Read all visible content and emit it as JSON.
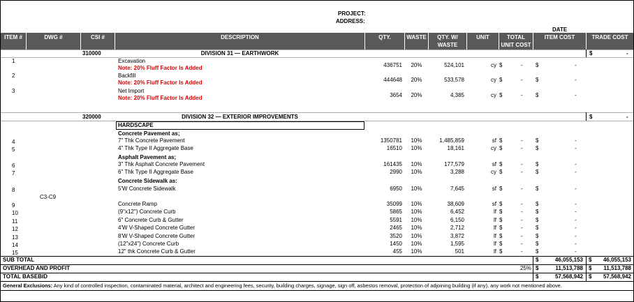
{
  "header": {
    "project_label": "PROJECT:",
    "address_label": "ADDRESS:",
    "date_label": "DATE"
  },
  "columns": {
    "item": "ITEM #",
    "dwg": "DWG #",
    "csi": "CSI #",
    "description": "DESCRIPTION",
    "qty": "QTY.",
    "waste": "WASTE",
    "qty_w_1": "QTY. W/",
    "qty_w_2": "WASTE",
    "unit": "UNIT",
    "total_1": "TOTAL",
    "total_2": "UNIT COST",
    "item_cost": "ITEM COST",
    "trade_cost": "TRADE COST"
  },
  "divisions": [
    {
      "csi": "310000",
      "title": "DIVISION 31 — EARTHWORK",
      "currency": "$",
      "trade": "-"
    },
    {
      "csi": "320000",
      "title": "DIVISION 32 — EXTERIOR IMPROVEMENTS",
      "currency": "$",
      "trade": "-"
    }
  ],
  "earthwork_items": [
    {
      "num": "1",
      "desc": "Excavation",
      "note": "Note: 20% Fluff Factor Is Added",
      "qty": "436751",
      "waste": "20%",
      "qtyw": "524,101",
      "unit": "cy",
      "cur1": "$",
      "unitcost": "-",
      "cur2": "$",
      "itemcost": "-"
    },
    {
      "num": "2",
      "desc": "Backfill",
      "note": "Note: 20% Fluff Factor Is Added",
      "qty": "444648",
      "waste": "20%",
      "qtyw": "533,578",
      "unit": "cy",
      "cur1": "$",
      "unitcost": "-",
      "cur2": "$",
      "itemcost": "-"
    },
    {
      "num": "3",
      "desc": "Net Import",
      "note": "Note: 20% Fluff Factor Is Added",
      "qty": "3654",
      "waste": "20%",
      "qtyw": "4,385",
      "unit": "cy",
      "cur1": "$",
      "unitcost": "-",
      "cur2": "$",
      "itemcost": "-"
    }
  ],
  "hardscape": {
    "heading": "HARDSCAPE",
    "sub1": "Concrete Pavement as;",
    "sub2": "Asphalt  Pavement as;",
    "sub3": "Concrete Sidewalk as:",
    "dwg": "C3-C9"
  },
  "improvement_items": [
    {
      "num": "4",
      "desc": "7\" Thk Concrete Pavement",
      "qty": "1350781",
      "waste": "10%",
      "qtyw": "1,485,859",
      "unit": "sf",
      "cur1": "$",
      "unitcost": "-",
      "cur2": "$",
      "itemcost": "-"
    },
    {
      "num": "5",
      "desc": "4\" Thk Type II Aggregate Base",
      "qty": "16510",
      "waste": "10%",
      "qtyw": "18,161",
      "unit": "cy",
      "cur1": "$",
      "unitcost": "-",
      "cur2": "$",
      "itemcost": "-"
    },
    {
      "num": "6",
      "desc": "3\" Thk Asphalt Concrete Pavement",
      "qty": "161435",
      "waste": "10%",
      "qtyw": "177,579",
      "unit": "sf",
      "cur1": "$",
      "unitcost": "-",
      "cur2": "$",
      "itemcost": "-"
    },
    {
      "num": "7",
      "desc": "6\" Thk Type II Aggregate Base",
      "qty": "2990",
      "waste": "10%",
      "qtyw": "3,288",
      "unit": "cy",
      "cur1": "$",
      "unitcost": "-",
      "cur2": "$",
      "itemcost": "-"
    },
    {
      "num": "8",
      "desc": "5'W Concrete Sidewalk",
      "qty": "6950",
      "waste": "10%",
      "qtyw": "7,645",
      "unit": "sf",
      "cur1": "$",
      "unitcost": "-",
      "cur2": "$",
      "itemcost": "-"
    },
    {
      "num": "9",
      "desc": "Concrete Ramp",
      "qty": "35099",
      "waste": "10%",
      "qtyw": "38,609",
      "unit": "sf",
      "cur1": "$",
      "unitcost": "-",
      "cur2": "$",
      "itemcost": "-"
    },
    {
      "num": "10",
      "desc": "(9\"x12\") Concrete Curb",
      "qty": "5865",
      "waste": "10%",
      "qtyw": "6,452",
      "unit": "lf",
      "cur1": "$",
      "unitcost": "-",
      "cur2": "$",
      "itemcost": "-"
    },
    {
      "num": "11",
      "desc": "6\" Concrete Curb & Gutter",
      "qty": "5591",
      "waste": "10%",
      "qtyw": "6,150",
      "unit": "lf",
      "cur1": "$",
      "unitcost": "-",
      "cur2": "$",
      "itemcost": "-"
    },
    {
      "num": "12",
      "desc": "4'W V-Shaped Concrete  Gutter",
      "qty": "2465",
      "waste": "10%",
      "qtyw": "2,712",
      "unit": "lf",
      "cur1": "$",
      "unitcost": "-",
      "cur2": "$",
      "itemcost": "-"
    },
    {
      "num": "13",
      "desc": "8'W V-Shaped Concrete  Gutter",
      "qty": "3520",
      "waste": "10%",
      "qtyw": "3,872",
      "unit": "lf",
      "cur1": "$",
      "unitcost": "-",
      "cur2": "$",
      "itemcost": "-"
    },
    {
      "num": "14",
      "desc": "(12\"x24\") Concrete Curb",
      "qty": "1450",
      "waste": "10%",
      "qtyw": "1,595",
      "unit": "lf",
      "cur1": "$",
      "unitcost": "-",
      "cur2": "$",
      "itemcost": "-"
    },
    {
      "num": "15",
      "desc": "12\" thk Concrete Curb  &  Gutter",
      "qty": "455",
      "waste": "10%",
      "qtyw": "501",
      "unit": "lf",
      "cur1": "$",
      "unitcost": "-",
      "cur2": "$",
      "itemcost": "-"
    }
  ],
  "totals": {
    "subtotal_label": "SUB TOTAL",
    "subtotal_cur": "$",
    "subtotal_item": "46,055,153",
    "subtotal_cur2": "$",
    "subtotal_trade": "46,055,153",
    "overhead_label": "OVERHEAD AND PROFIT",
    "overhead_pct": "25%",
    "overhead_cur": "$",
    "overhead_item": "11,513,788",
    "overhead_cur2": "$",
    "overhead_trade": "11,513,788",
    "basebid_label": "TOTAL BASEBID",
    "basebid_cur": "$",
    "basebid_item": "57,568,942",
    "basebid_cur2": "$",
    "basebid_trade": "57,568,942"
  },
  "exclusions": {
    "label": "General Exclusions:",
    "text": "Any kind of controlled inspection, contaminated material, architect and engineering fees, security, building charges, signage, sign off, asbestos removal, protection of adjoining building (if any), any work not mentioned above."
  }
}
